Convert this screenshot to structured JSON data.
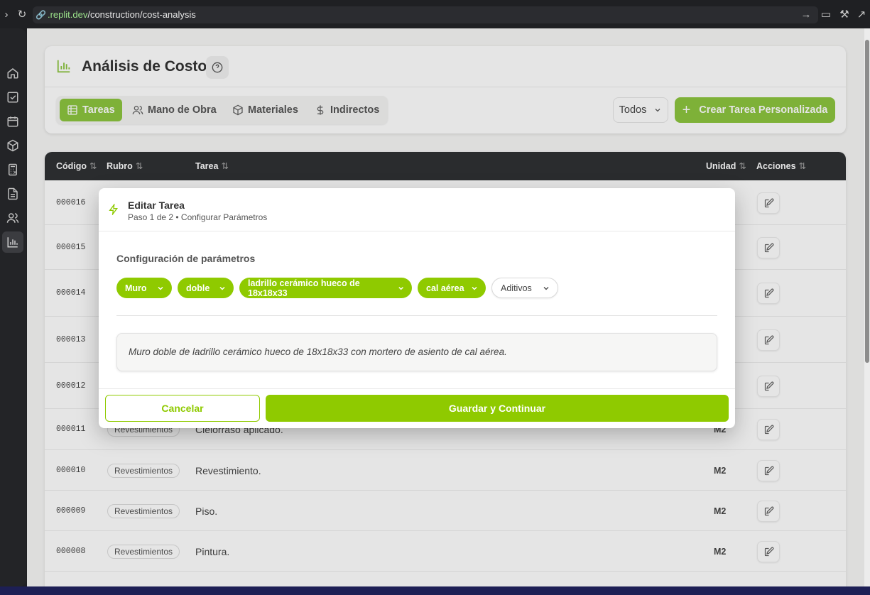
{
  "browser": {
    "url_host": ".replit.dev",
    "url_path": "/construction/cost-analysis"
  },
  "sidebar": {
    "items": [
      {
        "icon": "home-icon"
      },
      {
        "icon": "check-square-icon"
      },
      {
        "icon": "calendar-icon"
      },
      {
        "icon": "box-icon"
      },
      {
        "icon": "calculator-icon"
      },
      {
        "icon": "document-icon"
      },
      {
        "icon": "users-icon"
      },
      {
        "icon": "bar-chart-icon",
        "active": true
      }
    ]
  },
  "header": {
    "title": "Análisis de Costos",
    "tabs": [
      {
        "label": "Tareas",
        "icon": "table-icon",
        "active": true
      },
      {
        "label": "Mano de Obra",
        "icon": "users-icon"
      },
      {
        "label": "Materiales",
        "icon": "box-icon"
      },
      {
        "label": "Indirectos",
        "icon": "dollar-icon"
      }
    ],
    "filter_label": "Todos",
    "create_button_label": "Crear Tarea Personalizada"
  },
  "table": {
    "columns": [
      "Código",
      "Rubro",
      "Tarea",
      "Unidad",
      "Acciones"
    ],
    "rows": [
      {
        "code": "000016",
        "rubro": "",
        "tarea": "",
        "unidad": ""
      },
      {
        "code": "000015",
        "rubro": "",
        "tarea": "",
        "unidad": ""
      },
      {
        "code": "000014",
        "rubro": "",
        "tarea": "",
        "unidad": ""
      },
      {
        "code": "000013",
        "rubro": "",
        "tarea": "",
        "unidad": ""
      },
      {
        "code": "000012",
        "rubro": "",
        "tarea": "",
        "unidad": ""
      },
      {
        "code": "000011",
        "rubro": "Revestimientos",
        "tarea": "Cielorraso aplicado.",
        "unidad": "M2"
      },
      {
        "code": "000010",
        "rubro": "Revestimientos",
        "tarea": "Revestimiento.",
        "unidad": "M2"
      },
      {
        "code": "000009",
        "rubro": "Revestimientos",
        "tarea": "Piso.",
        "unidad": "M2"
      },
      {
        "code": "000008",
        "rubro": "Revestimientos",
        "tarea": "Pintura.",
        "unidad": "M2"
      }
    ]
  },
  "modal": {
    "title": "Editar Tarea",
    "subtitle": "Paso 1 de 2 • Configurar Parámetros",
    "section_title": "Configuración de parámetros",
    "params": [
      {
        "label": "Muro",
        "selected": true
      },
      {
        "label": "doble",
        "selected": true
      },
      {
        "label": "ladrillo cerámico hueco de 18x18x33",
        "selected": true
      },
      {
        "label": "cal aérea",
        "selected": true
      },
      {
        "label": "Aditivos",
        "selected": false
      }
    ],
    "preview_text": "Muro doble de ladrillo cerámico hueco de 18x18x33 con mortero de asiento de cal aérea.",
    "cancel_label": "Cancelar",
    "save_label": "Guardar y Continuar"
  },
  "colors": {
    "accent": "#8fca00",
    "table_header": "#2f3134"
  }
}
